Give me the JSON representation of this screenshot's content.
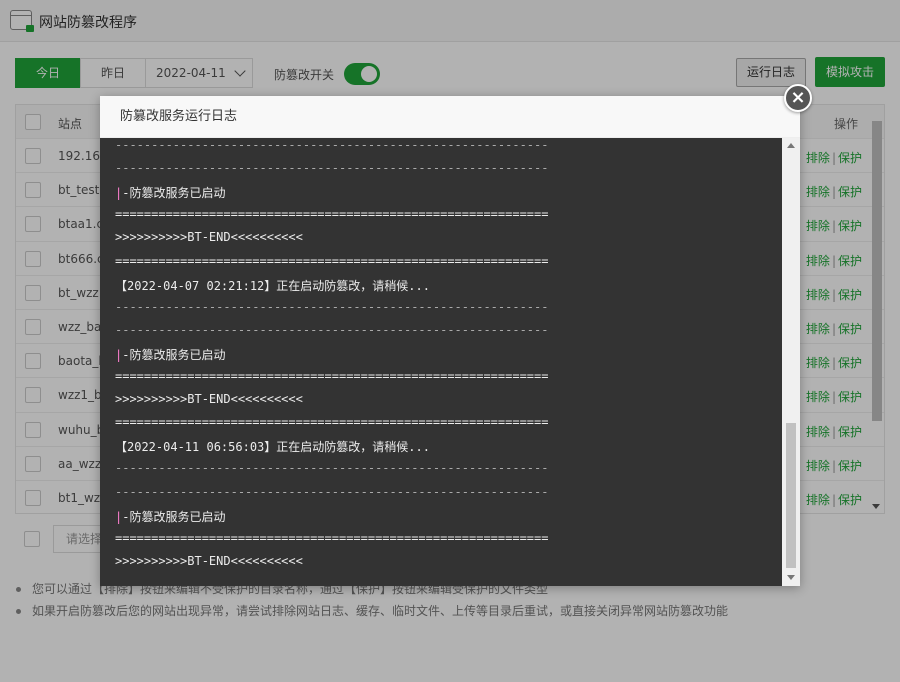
{
  "app": {
    "title": "网站防篡改程序"
  },
  "toolbar": {
    "tab_today": "今日",
    "tab_yesterday": "昨日",
    "date_value": "2022-04-11",
    "switch_label": "防篡改开关",
    "switch_on": true,
    "log_button": "运行日志",
    "attack_button": "模拟攻击"
  },
  "table": {
    "col_site": "站点",
    "col_ops": "操作",
    "op_exclude": "排除",
    "op_protect": "保护",
    "op_sep": "|",
    "rows": [
      {
        "site": "192.168"
      },
      {
        "site": "bt_test."
      },
      {
        "site": "btaa1.c"
      },
      {
        "site": "bt666.c"
      },
      {
        "site": "bt_wzz."
      },
      {
        "site": "wzz_ba"
      },
      {
        "site": "baota_b"
      },
      {
        "site": "wzz1_b"
      },
      {
        "site": "wuhu_b"
      },
      {
        "site": "aa_wzz"
      },
      {
        "site": "bt1_wz"
      }
    ]
  },
  "batch": {
    "placeholder": "请选择"
  },
  "tips": [
    "您可以通过【排除】按钮来编辑不受保护的目录名称，通过【保护】按钮来编辑受保护的文件类型",
    "如果开启防篡改后您的网站出现异常，请尝试排除网站日志、缓存、临时文件、上传等目录后重试，或直接关闭异常网站防篡改功能"
  ],
  "modal": {
    "title": "防篡改服务运行日志",
    "close_glyph": "×",
    "log_lines": [
      {
        "text": "------------------------------------------------------------",
        "kind": "dash"
      },
      {
        "text": "------------------------------------------------------------",
        "kind": "dash"
      },
      {
        "text": "-防篡改服务已启动",
        "kind": "status"
      },
      {
        "text": "============================================================",
        "kind": "eq"
      },
      {
        "text": ">>>>>>>>>>BT-END<<<<<<<<<<",
        "kind": "end"
      },
      {
        "text": "============================================================",
        "kind": "eq"
      },
      {
        "text": "【2022-04-07 02:21:12】正在启动防篡改，请稍候...",
        "kind": "start"
      },
      {
        "text": "------------------------------------------------------------",
        "kind": "dash"
      },
      {
        "text": "------------------------------------------------------------",
        "kind": "dash"
      },
      {
        "text": "-防篡改服务已启动",
        "kind": "status"
      },
      {
        "text": "============================================================",
        "kind": "eq"
      },
      {
        "text": ">>>>>>>>>>BT-END<<<<<<<<<<",
        "kind": "end"
      },
      {
        "text": "============================================================",
        "kind": "eq"
      },
      {
        "text": "【2022-04-11 06:56:03】正在启动防篡改，请稍候...",
        "kind": "start"
      },
      {
        "text": "------------------------------------------------------------",
        "kind": "dash"
      },
      {
        "text": "------------------------------------------------------------",
        "kind": "dash"
      },
      {
        "text": "-防篡改服务已启动",
        "kind": "status"
      },
      {
        "text": "============================================================",
        "kind": "eq"
      },
      {
        "text": ">>>>>>>>>>BT-END<<<<<<<<<<",
        "kind": "end"
      }
    ]
  },
  "colors": {
    "accent_green": "#20a53a",
    "console_bg": "#333333",
    "status_bar_pink": "#ff7fd0"
  }
}
